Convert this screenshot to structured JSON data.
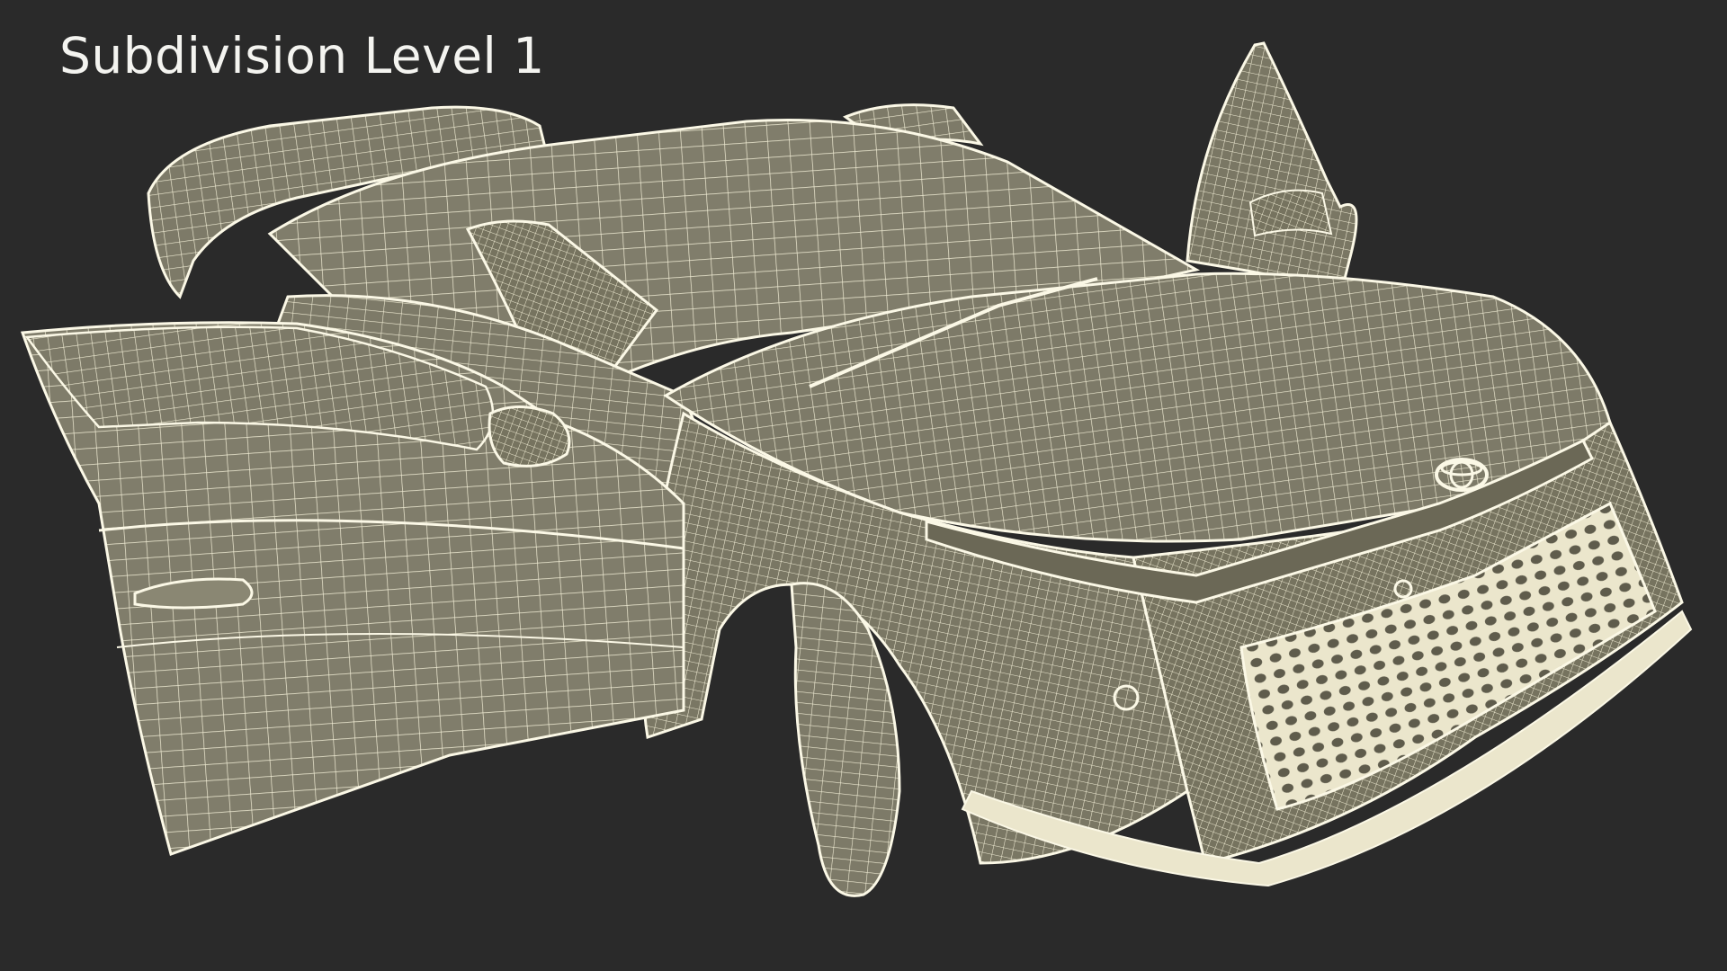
{
  "caption": "Subdivision Level 1",
  "colors": {
    "background": "#2a2a2a",
    "surface": "#7d7a68",
    "wire": "#f0ecd4",
    "outline": "#fbf8e6"
  },
  "subject": "toyota-race-car-wireframe-icon"
}
